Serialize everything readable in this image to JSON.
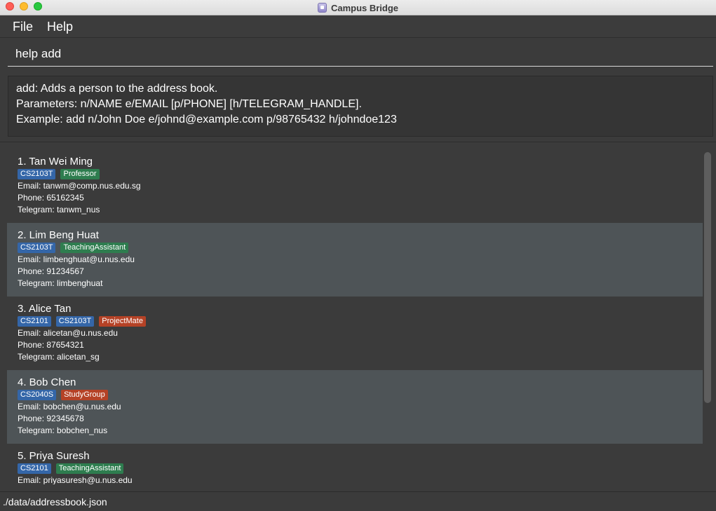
{
  "window": {
    "title": "Campus Bridge",
    "icon": "app-icon"
  },
  "menu": {
    "file": "File",
    "help": "Help"
  },
  "command": {
    "value": "help add"
  },
  "result": {
    "lines": [
      "add: Adds a person to the address book.",
      "Parameters: n/NAME e/EMAIL [p/PHONE] [h/TELEGRAM_HANDLE].",
      "Example: add n/John Doe e/johnd@example.com p/98765432 h/johndoe123"
    ]
  },
  "colors": {
    "module_tag": "#3466a8",
    "role_tag_green": "#2e7d4f",
    "role_tag_red": "#b54226"
  },
  "persons": [
    {
      "name": "1. Tan Wei Ming",
      "tags": [
        {
          "label": "CS2103T",
          "color": "#3466a8"
        },
        {
          "label": "Professor",
          "color": "#2e7d4f"
        }
      ],
      "email": "Email: tanwm@comp.nus.edu.sg",
      "phone": "Phone: 65162345",
      "telegram": "Telegram: tanwm_nus"
    },
    {
      "name": "2. Lim Beng Huat",
      "tags": [
        {
          "label": "CS2103T",
          "color": "#3466a8"
        },
        {
          "label": "TeachingAssistant",
          "color": "#2e7d4f"
        }
      ],
      "email": "Email: limbenghuat@u.nus.edu",
      "phone": "Phone: 91234567",
      "telegram": "Telegram: limbenghuat"
    },
    {
      "name": "3. Alice Tan",
      "tags": [
        {
          "label": "CS2101",
          "color": "#3466a8"
        },
        {
          "label": "CS2103T",
          "color": "#3466a8"
        },
        {
          "label": "ProjectMate",
          "color": "#b54226"
        }
      ],
      "email": "Email: alicetan@u.nus.edu",
      "phone": "Phone: 87654321",
      "telegram": "Telegram: alicetan_sg"
    },
    {
      "name": "4. Bob Chen",
      "tags": [
        {
          "label": "CS2040S",
          "color": "#3466a8"
        },
        {
          "label": "StudyGroup",
          "color": "#b54226"
        }
      ],
      "email": "Email: bobchen@u.nus.edu",
      "phone": "Phone: 92345678",
      "telegram": "Telegram: bobchen_nus"
    },
    {
      "name": "5. Priya Suresh",
      "tags": [
        {
          "label": "CS2101",
          "color": "#3466a8"
        },
        {
          "label": "TeachingAssistant",
          "color": "#2e7d4f"
        }
      ],
      "email": "Email: priyasuresh@u.nus.edu",
      "phone": "",
      "telegram": ""
    }
  ],
  "status": {
    "path": "./data/addressbook.json"
  }
}
